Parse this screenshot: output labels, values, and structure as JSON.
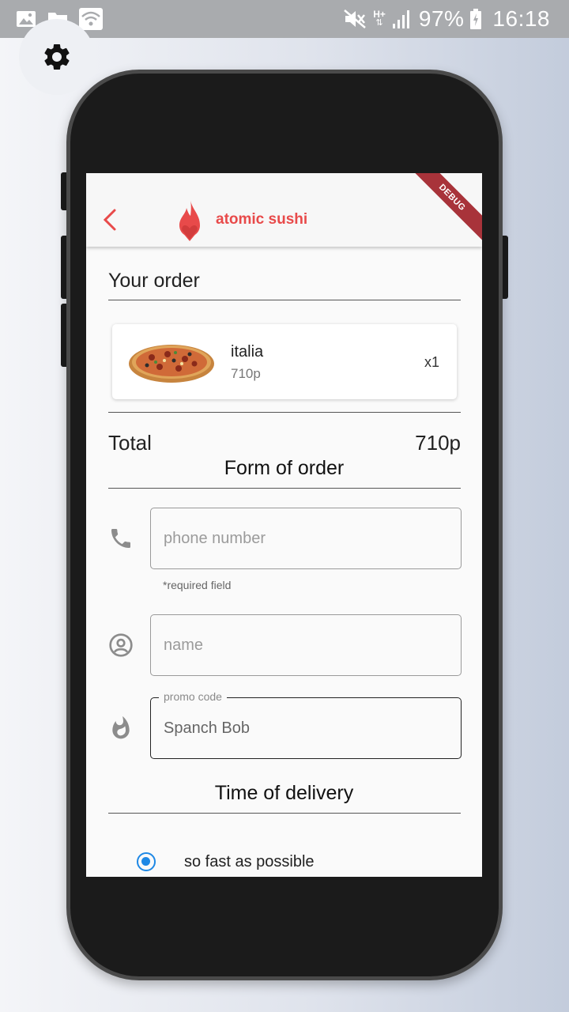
{
  "status_bar": {
    "icons": [
      "image-icon",
      "folder-icon",
      "wifi-icon",
      "mute-icon",
      "network-h-plus-icon",
      "signal-icon",
      "battery-charging-icon"
    ],
    "network_label": "H+",
    "battery": "97%",
    "time": "16:18"
  },
  "app_bar": {
    "brand": "atomic sushi",
    "debug_banner": "DEBUG",
    "accent_color": "#e84a4a"
  },
  "order": {
    "title": "Your order",
    "items": [
      {
        "name": "italia",
        "price": "710p",
        "quantity": "x1"
      }
    ],
    "total_label": "Total",
    "total_value": "710p"
  },
  "form": {
    "title": "Form of order",
    "phone": {
      "placeholder": "phone number",
      "helper": "*required field"
    },
    "name": {
      "placeholder": "name"
    },
    "promo": {
      "label": "promo code",
      "value": "Spanch Bob"
    }
  },
  "delivery": {
    "title": "Time of delivery",
    "options": [
      {
        "label": "so fast as possible",
        "selected": true
      }
    ],
    "radio_color": "#1e88e5"
  }
}
